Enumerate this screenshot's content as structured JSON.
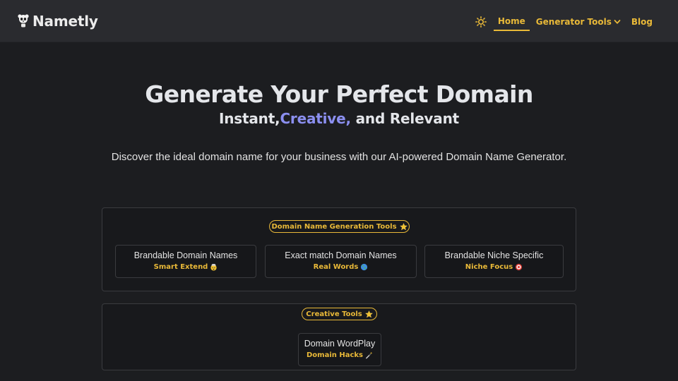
{
  "header": {
    "brand": "Nametly",
    "nav": [
      {
        "label": "Home",
        "active": true
      },
      {
        "label": "Generator Tools",
        "dropdown": true
      },
      {
        "label": "Blog"
      }
    ],
    "icons": {
      "logo": "panda-logo-icon",
      "theme": "sun-icon",
      "dropdown": "chevron-down-icon"
    }
  },
  "hero": {
    "title": "Generate Your Perfect Domain",
    "subtitle_part1": "Instant,",
    "subtitle_highlight": "Creative,",
    "subtitle_part2": " and Relevant",
    "description": "Discover the ideal domain name for your business with our AI-powered Domain Name Generator."
  },
  "sections": [
    {
      "badge": "Domain Name Generation Tools",
      "badge_icon": "star-emoji",
      "cards": [
        {
          "title": "Brandable Domain Names",
          "tag": "Smart Extend",
          "emoji": "mind-blown-emoji"
        },
        {
          "title": "Exact match Domain Names",
          "tag": "Real Words",
          "emoji": "globe-emoji"
        },
        {
          "title": "Brandable Niche Specific",
          "tag": "Niche Focus",
          "emoji": "target-emoji"
        }
      ]
    },
    {
      "badge": "Creative Tools",
      "badge_icon": "star-emoji",
      "cards": [
        {
          "title": "Domain WordPlay",
          "tag": "Domain Hacks",
          "emoji": "magic-wand-emoji"
        }
      ]
    }
  ],
  "colors": {
    "background": "#1c1d20",
    "navbar": "#2a2b2f",
    "accent": "#e9b938",
    "highlight": "#8b8ff0",
    "card_border": "#3a3b3f"
  }
}
